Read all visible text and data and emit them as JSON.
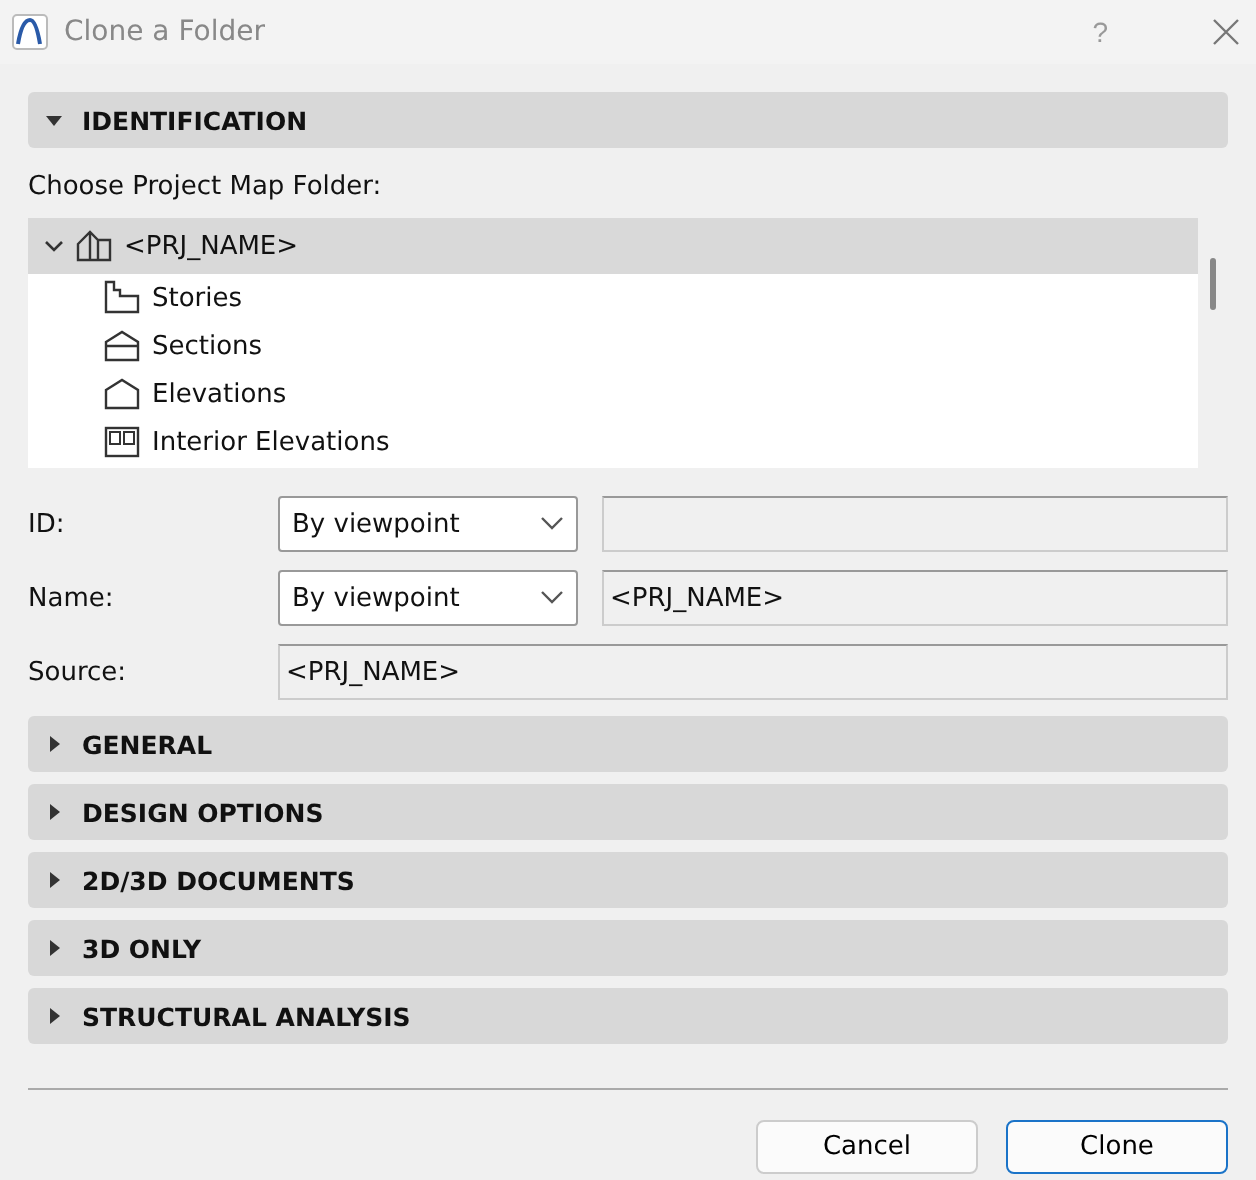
{
  "window": {
    "title": "Clone a Folder",
    "help": "?"
  },
  "sections": [
    {
      "label": "IDENTIFICATION",
      "expanded": true
    },
    {
      "label": "GENERAL",
      "expanded": false
    },
    {
      "label": "DESIGN OPTIONS",
      "expanded": false
    },
    {
      "label": "2D/3D DOCUMENTS",
      "expanded": false
    },
    {
      "label": "3D ONLY",
      "expanded": false
    },
    {
      "label": "STRUCTURAL ANALYSIS",
      "expanded": false
    }
  ],
  "tree_label": "Choose Project Map Folder:",
  "tree": [
    {
      "label": "<PRJ_NAME>",
      "kind": "project",
      "selected": true,
      "expanded": true,
      "children": [
        {
          "label": "Stories",
          "kind": "stories",
          "selected": false
        },
        {
          "label": "Sections",
          "kind": "sections",
          "selected": false
        },
        {
          "label": "Elevations",
          "kind": "elevations",
          "selected": false
        },
        {
          "label": "Interior Elevations",
          "kind": "interior",
          "selected": false
        }
      ]
    }
  ],
  "fields": [
    {
      "label": "ID:",
      "dropdown": "By viewpoint"
    },
    {
      "label": "Name:",
      "dropdown": "By viewpoint",
      "value": "<PRJ_NAME>"
    },
    {
      "label": "Source:",
      "value": "<PRJ_NAME>"
    }
  ],
  "buttons": [
    {
      "label": "Cancel",
      "primary": false
    },
    {
      "label": "Clone",
      "primary": true
    }
  ]
}
